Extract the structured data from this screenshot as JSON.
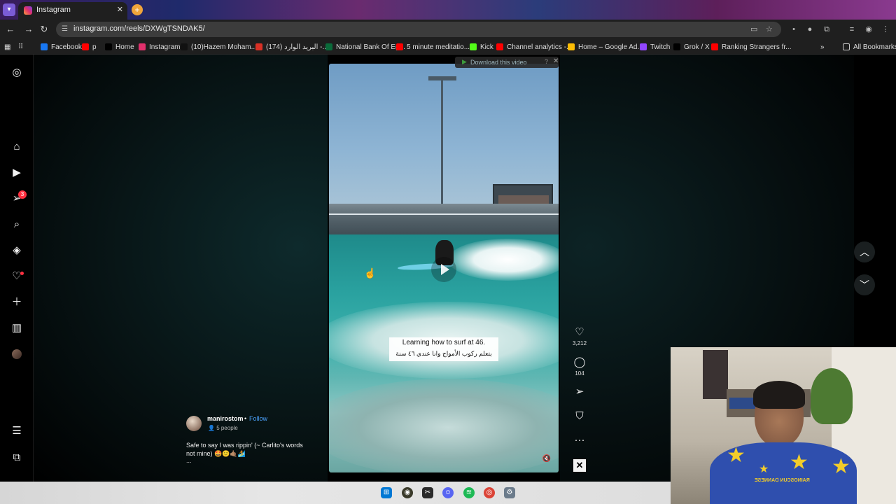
{
  "tab": {
    "title": "Instagram",
    "close": "✕",
    "new_tab": "+"
  },
  "toolbar": {
    "url": "instagram.com/reels/DXWgTSNDAK5/",
    "back": "←",
    "forward": "→",
    "reload": "↻"
  },
  "bookmarks": [
    {
      "label": "Facebook",
      "color": "#1877f2"
    },
    {
      "label": "p",
      "color": "#ff0000"
    },
    {
      "label": "Home",
      "color": "#000000"
    },
    {
      "label": "Instagram",
      "color": "#e1306c"
    },
    {
      "label": "(10)Hazem Moham...",
      "color": "#111111"
    },
    {
      "label": "(174) البريد الوارد -...",
      "color": "#d93025"
    },
    {
      "label": "National Bank Of Eg...",
      "color": "#0a6b3a"
    },
    {
      "label": "5 minute meditatio...",
      "color": "#ff0000"
    },
    {
      "label": "Kick",
      "color": "#53fc18"
    },
    {
      "label": "Channel analytics -...",
      "color": "#ff0000"
    },
    {
      "label": "Home – Google Ad...",
      "color": "#fbbc04"
    },
    {
      "label": "Twitch",
      "color": "#9146ff"
    },
    {
      "label": "Grok / X",
      "color": "#000000"
    },
    {
      "label": "Ranking Strangers fr...",
      "color": "#ff0000"
    }
  ],
  "all_bookmarks": "All Bookmarks",
  "sidebar": {
    "notification_count": "3"
  },
  "video": {
    "download_label": "Download this video",
    "caption_en": "Learning how to surf at 46.",
    "caption_ar": "بتعلم ركوب الأمواج وانا عندي ٤٦ سنة"
  },
  "actions": {
    "likes": "3,212",
    "comments": "104"
  },
  "author": {
    "username": "manirostom",
    "separator": "•",
    "follow": "Follow",
    "people": "5 people",
    "description": "Safe to say I was rippin' (~ Carlito's words not mine) 🤩🙂🤙🏽🏄",
    "more": "..."
  },
  "webcam": {
    "shirt_text": "ƎƧƎИИAᗡ ИUƆƧOИIAЯ"
  }
}
